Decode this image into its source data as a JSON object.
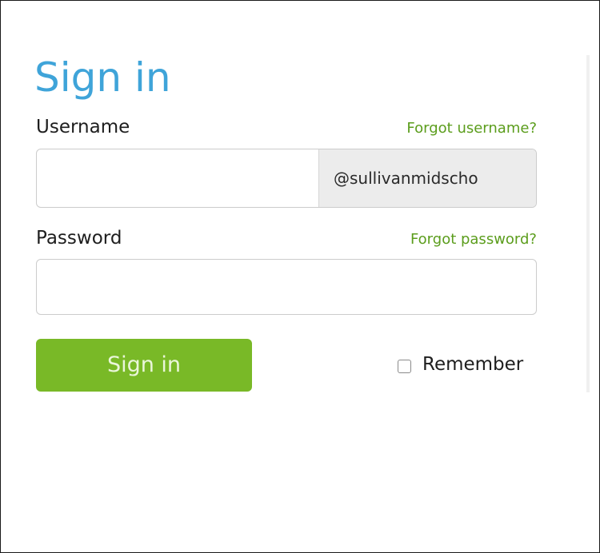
{
  "signin_form": {
    "title": "Sign in",
    "username": {
      "label": "Username",
      "forgot_link": "Forgot username?",
      "value": "",
      "domain_suffix": "@sullivanmidscho"
    },
    "password": {
      "label": "Password",
      "forgot_link": "Forgot password?",
      "value": ""
    },
    "submit_label": "Sign in",
    "remember": {
      "label": "Remember",
      "checked": false
    }
  },
  "colors": {
    "title": "#3fa4d9",
    "link": "#5b9d1c",
    "button": "#79b927",
    "suffix_bg": "#ececec"
  }
}
